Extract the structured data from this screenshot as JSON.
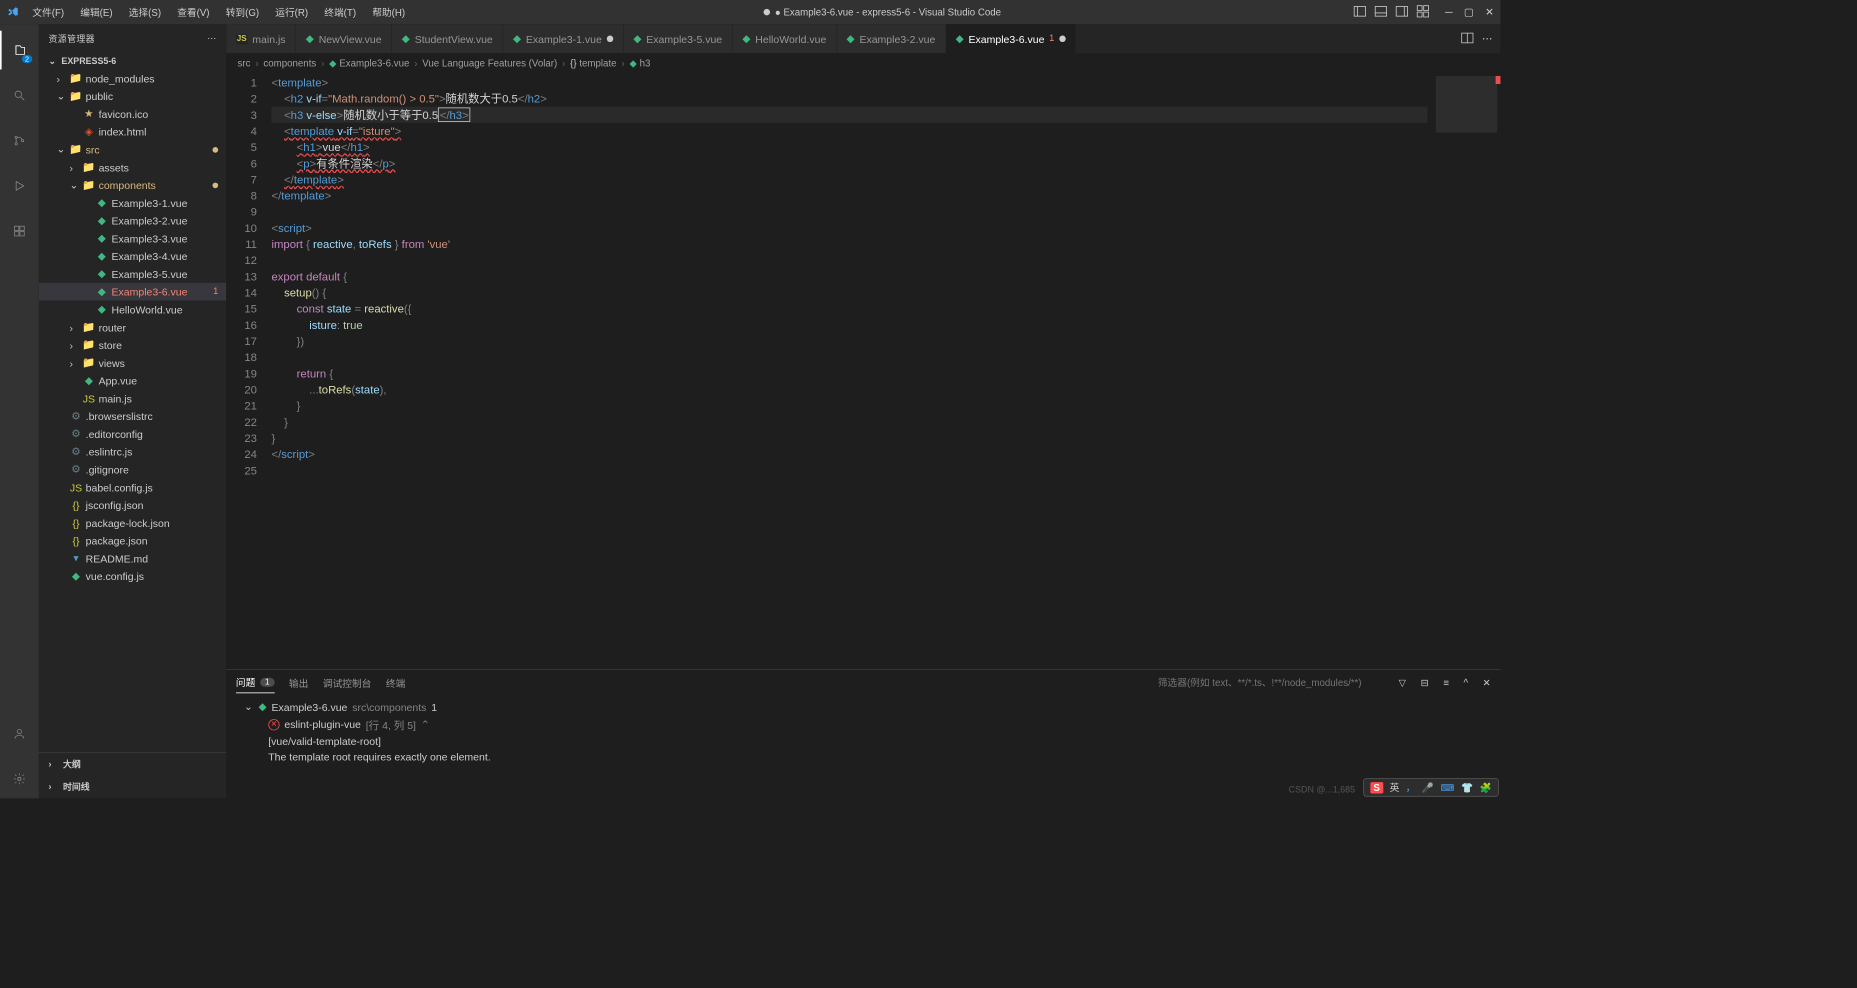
{
  "titlebar": {
    "menu": [
      "文件(F)",
      "编辑(E)",
      "选择(S)",
      "查看(V)",
      "转到(G)",
      "运行(R)",
      "终端(T)",
      "帮助(H)"
    ],
    "title_prefix": "● Example3-6.vue - express5-6 - Visual Studio Code"
  },
  "activitybar": {
    "badge": "2"
  },
  "sidebar": {
    "title": "资源管理器",
    "project": "EXPRESS5-6",
    "tree": [
      {
        "type": "folder",
        "label": "node_modules",
        "indent": 1,
        "open": false,
        "icon": "folder"
      },
      {
        "type": "folder",
        "label": "public",
        "indent": 1,
        "open": true,
        "icon": "folder"
      },
      {
        "type": "file",
        "label": "favicon.ico",
        "indent": 2,
        "icon": "ico"
      },
      {
        "type": "file",
        "label": "index.html",
        "indent": 2,
        "icon": "html"
      },
      {
        "type": "folder",
        "label": "src",
        "indent": 1,
        "open": true,
        "icon": "folder",
        "mod": true
      },
      {
        "type": "folder",
        "label": "assets",
        "indent": 2,
        "open": false,
        "icon": "folder"
      },
      {
        "type": "folder",
        "label": "components",
        "indent": 2,
        "open": true,
        "icon": "folder",
        "mod": true
      },
      {
        "type": "file",
        "label": "Example3-1.vue",
        "indent": 3,
        "icon": "vue"
      },
      {
        "type": "file",
        "label": "Example3-2.vue",
        "indent": 3,
        "icon": "vue"
      },
      {
        "type": "file",
        "label": "Example3-3.vue",
        "indent": 3,
        "icon": "vue"
      },
      {
        "type": "file",
        "label": "Example3-4.vue",
        "indent": 3,
        "icon": "vue"
      },
      {
        "type": "file",
        "label": "Example3-5.vue",
        "indent": 3,
        "icon": "vue"
      },
      {
        "type": "file",
        "label": "Example3-6.vue",
        "indent": 3,
        "icon": "vue",
        "selected": true,
        "err": true,
        "errCount": "1"
      },
      {
        "type": "file",
        "label": "HelloWorld.vue",
        "indent": 3,
        "icon": "vue"
      },
      {
        "type": "folder",
        "label": "router",
        "indent": 2,
        "open": false,
        "icon": "folder"
      },
      {
        "type": "folder",
        "label": "store",
        "indent": 2,
        "open": false,
        "icon": "folder"
      },
      {
        "type": "folder",
        "label": "views",
        "indent": 2,
        "open": false,
        "icon": "folder"
      },
      {
        "type": "file",
        "label": "App.vue",
        "indent": 2,
        "icon": "vue"
      },
      {
        "type": "file",
        "label": "main.js",
        "indent": 2,
        "icon": "js"
      },
      {
        "type": "file",
        "label": ".browserslistrc",
        "indent": 1,
        "icon": "cfg"
      },
      {
        "type": "file",
        "label": ".editorconfig",
        "indent": 1,
        "icon": "cfg"
      },
      {
        "type": "file",
        "label": ".eslintrc.js",
        "indent": 1,
        "icon": "cfg"
      },
      {
        "type": "file",
        "label": ".gitignore",
        "indent": 1,
        "icon": "cfg"
      },
      {
        "type": "file",
        "label": "babel.config.js",
        "indent": 1,
        "icon": "js"
      },
      {
        "type": "file",
        "label": "jsconfig.json",
        "indent": 1,
        "icon": "json"
      },
      {
        "type": "file",
        "label": "package-lock.json",
        "indent": 1,
        "icon": "json"
      },
      {
        "type": "file",
        "label": "package.json",
        "indent": 1,
        "icon": "json"
      },
      {
        "type": "file",
        "label": "README.md",
        "indent": 1,
        "icon": "md"
      },
      {
        "type": "file",
        "label": "vue.config.js",
        "indent": 1,
        "icon": "vue"
      }
    ],
    "outline": "大纲",
    "timeline": "时间线"
  },
  "tabs": [
    {
      "icon": "js",
      "label": "main.js"
    },
    {
      "icon": "vue",
      "label": "NewView.vue"
    },
    {
      "icon": "vue",
      "label": "StudentView.vue"
    },
    {
      "icon": "vue",
      "label": "Example3-1.vue",
      "mod": true
    },
    {
      "icon": "vue",
      "label": "Example3-5.vue"
    },
    {
      "icon": "vue",
      "label": "HelloWorld.vue"
    },
    {
      "icon": "vue",
      "label": "Example3-2.vue"
    },
    {
      "icon": "vue",
      "label": "Example3-6.vue",
      "active": true,
      "err": "1",
      "mod": true
    }
  ],
  "breadcrumb": [
    "src",
    "components",
    "Example3-6.vue",
    "Vue Language Features (Volar)",
    "{} template",
    "h3"
  ],
  "code": {
    "lines": 25,
    "content_html": [
      "<span class='punct'>&lt;</span><span class='tag'>template</span><span class='punct'>&gt;</span>",
      "    <span class='punct'>&lt;</span><span class='tag'>h2</span> <span class='attr'>v-if</span><span class='punct'>=</span><span class='str'>\"Math.random() &gt; 0.5\"</span><span class='punct'>&gt;</span><span class='txt'>随机数大于0.5</span><span class='punct'>&lt;/</span><span class='tag'>h2</span><span class='punct'>&gt;</span>",
      "    <span class='punct'>&lt;</span><span class='tag'>h3</span> <span class='attr'>v-else</span><span class='punct'>&gt;</span><span class='txt'>随机数小于等于0.5</span><span class='cursor-box'><span class='punct'>&lt;/</span><span class='tag'>h3</span><span class='punct'>&gt;</span></span>",
      "    <span class='squiggle'><span class='punct'>&lt;</span><span class='tag'>template</span> <span class='attr'>v-if</span><span class='punct'>=</span><span class='str'>\"isture\"</span><span class='punct'>&gt;</span></span>",
      "        <span class='squiggle'><span class='punct'>&lt;</span><span class='tag'>h1</span><span class='punct'>&gt;</span><span class='txt'>vue</span><span class='punct'>&lt;/</span><span class='tag'>h1</span><span class='punct'>&gt;</span></span>",
      "        <span class='squiggle'><span class='punct'>&lt;</span><span class='tag'>p</span><span class='punct'>&gt;</span><span class='txt'>有条件渲染</span><span class='punct'>&lt;/</span><span class='tag'>p</span><span class='punct'>&gt;</span></span>",
      "    <span class='squiggle'><span class='punct'>&lt;/</span><span class='tag'>template</span><span class='punct'>&gt;</span></span>",
      "<span class='punct'>&lt;/</span><span class='tag'>template</span><span class='punct'>&gt;</span>",
      "",
      "<span class='punct'>&lt;</span><span class='tag'>script</span><span class='punct'>&gt;</span>",
      "<span class='kw'>import</span> <span class='punct'>{</span> <span class='var'>reactive</span><span class='punct'>,</span> <span class='var'>toRefs</span> <span class='punct'>}</span> <span class='kw'>from</span> <span class='str'>'vue'</span>",
      "",
      "<span class='kw'>export</span> <span class='kw'>default</span> <span class='punct'>{</span>",
      "    <span class='fn'>setup</span><span class='punct'>() {</span>",
      "        <span class='kw'>const</span> <span class='var'>state</span> <span class='punct'>=</span> <span class='fn'>reactive</span><span class='punct'>({</span>",
      "            <span class='var'>isture</span><span class='punct'>:</span> <span class='num'>true</span>",
      "        <span class='punct'>})</span>",
      "",
      "        <span class='kw'>return</span> <span class='punct'>{</span>",
      "            <span class='punct'>...</span><span class='fn'>toRefs</span><span class='punct'>(</span><span class='var'>state</span><span class='punct'>),</span>",
      "        <span class='punct'>}</span>",
      "    <span class='punct'>}</span>",
      "<span class='punct'>}</span>",
      "<span class='punct'>&lt;/</span><span class='tag'>script</span><span class='punct'>&gt;</span>",
      ""
    ]
  },
  "panel": {
    "tabs": {
      "problems": "问题",
      "count": "1",
      "output": "输出",
      "debug": "调试控制台",
      "terminal": "终端"
    },
    "filter_placeholder": "筛选器(例如 text、**/*.ts、!**/node_modules/**)",
    "problem_file": "Example3-6.vue",
    "problem_path": "src\\components",
    "problem_badge": "1",
    "eslint": "eslint-plugin-vue",
    "location": "[行 4, 列 5]",
    "rule": "[vue/valid-template-root]",
    "msg": "The template root requires exactly one element."
  },
  "ime": {
    "sogou": "S",
    "lang": "英"
  },
  "watermark": "CSDN @...1,685"
}
